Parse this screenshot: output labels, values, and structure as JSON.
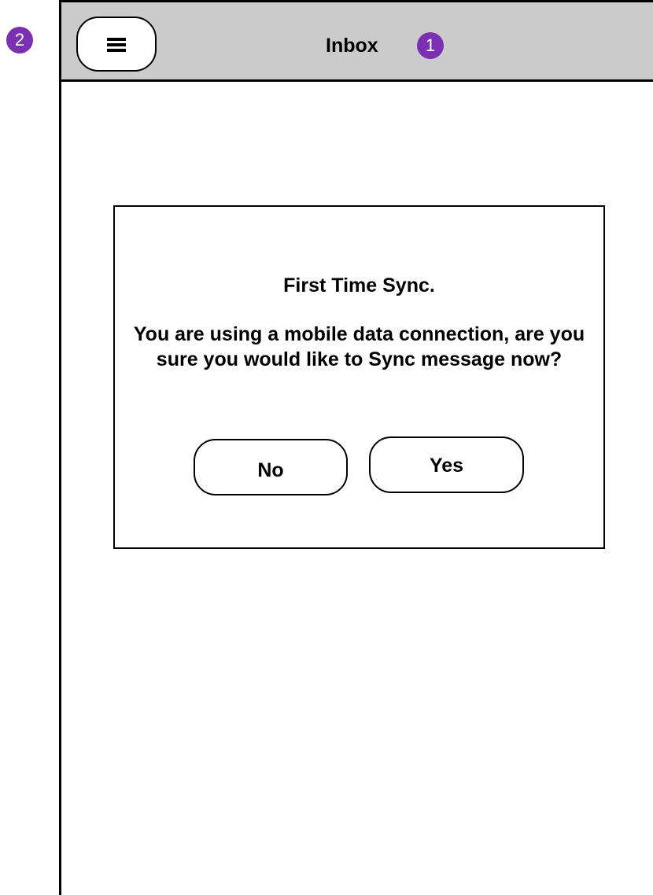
{
  "app": {
    "title": "Inbox"
  },
  "header": {
    "menu_icon": "hamburger-menu-icon"
  },
  "annotations": [
    {
      "label": "1"
    },
    {
      "label": "2"
    }
  ],
  "dialog": {
    "title": "First Time Sync.",
    "message": "You are using a mobile data connection, are you sure you would like to Sync message now?",
    "buttons": {
      "no": "No",
      "yes": "Yes"
    }
  },
  "colors": {
    "top_bar": "#cccbcb",
    "annotation_badge": "#7b2fb1",
    "border": "#000000",
    "background": "#ffffff"
  }
}
